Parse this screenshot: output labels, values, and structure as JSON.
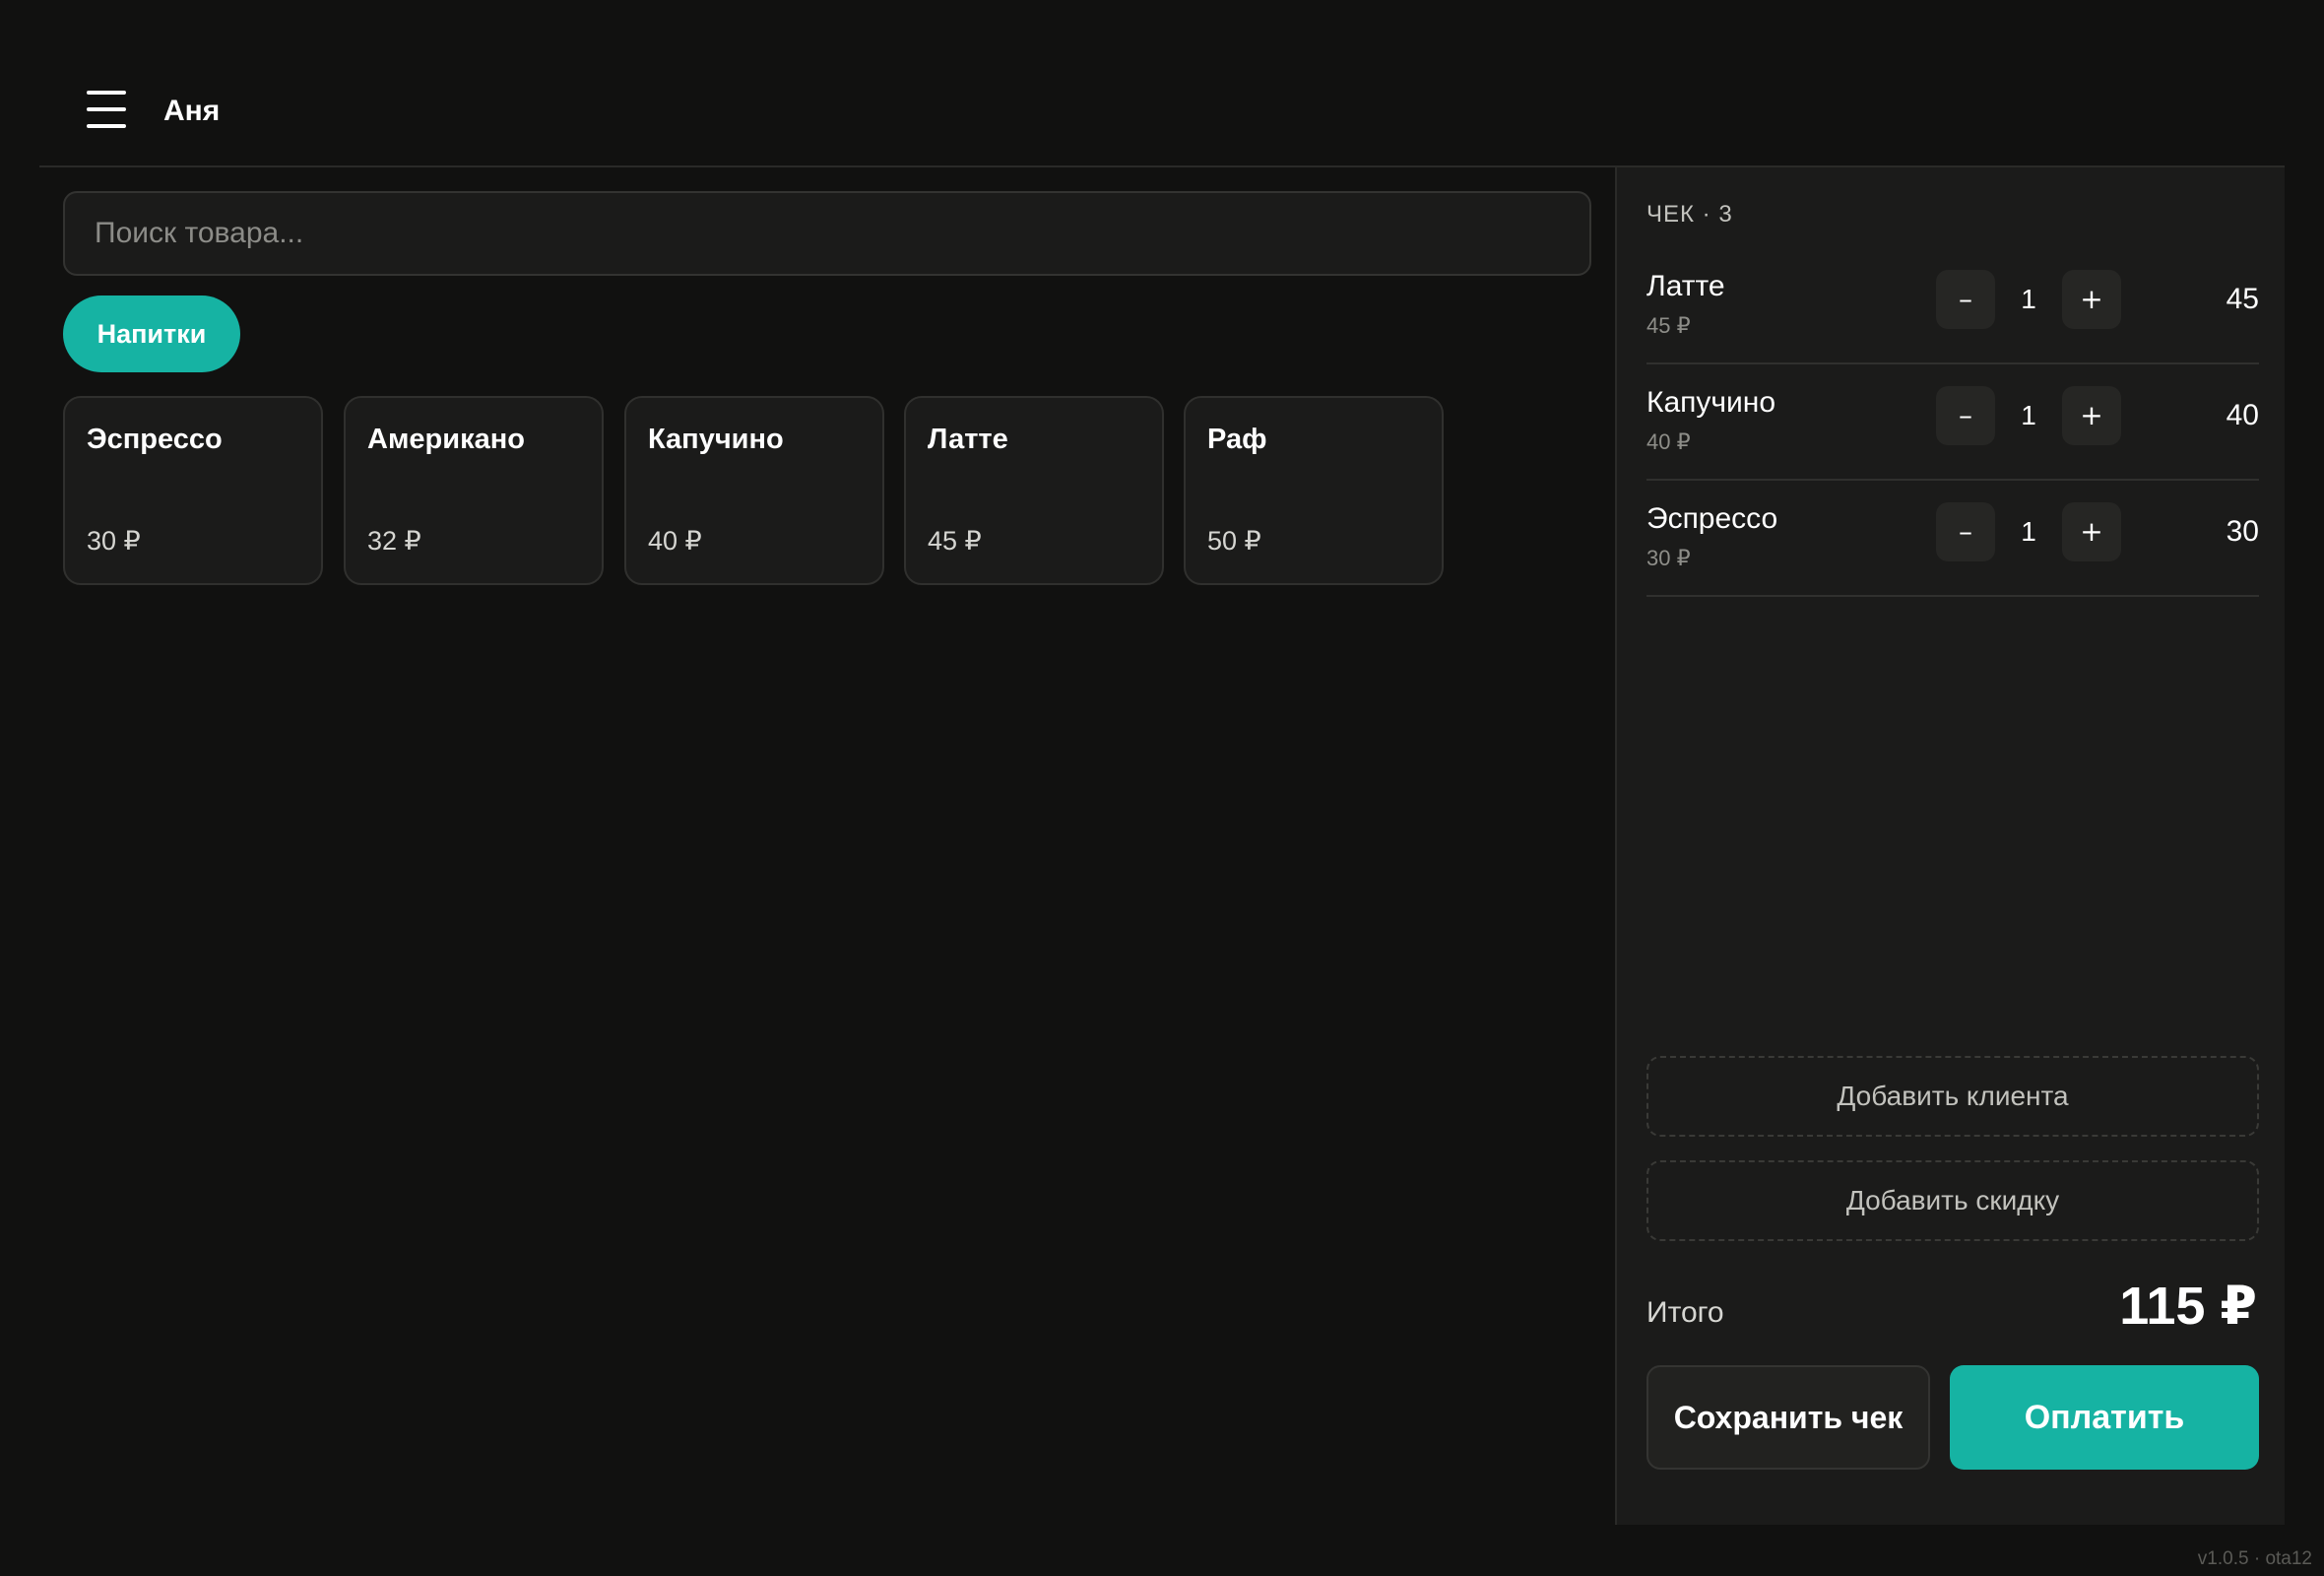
{
  "header": {
    "user_name": "Аня",
    "menu_icon": "hamburger-menu-icon"
  },
  "catalog": {
    "search_placeholder": "Поиск товара...",
    "category": "Напитки",
    "products": [
      {
        "name": "Эспрессо",
        "price": "30 ₽"
      },
      {
        "name": "Американо",
        "price": "32 ₽"
      },
      {
        "name": "Капучино",
        "price": "40 ₽"
      },
      {
        "name": "Латте",
        "price": "45 ₽"
      },
      {
        "name": "Раф",
        "price": "50 ₽"
      }
    ]
  },
  "receipt": {
    "title": "ЧЕК · 3",
    "lines": [
      {
        "name": "Латте",
        "unit_price": "45 ₽",
        "qty": "1",
        "total": "45"
      },
      {
        "name": "Капучино",
        "unit_price": "40 ₽",
        "qty": "1",
        "total": "40"
      },
      {
        "name": "Эспрессо",
        "unit_price": "30 ₽",
        "qty": "1",
        "total": "30"
      }
    ],
    "minus_label": "–",
    "plus_label": "+",
    "add_client_label": "Добавить клиента",
    "add_discount_label": "Добавить скидку",
    "total_label": "Итого",
    "total_value": "115 ₽",
    "save_label": "Сохранить чек",
    "pay_label": "Оплатить"
  },
  "version": "v1.0.5 · ota12",
  "colors": {
    "accent": "#16b3a3",
    "background": "#111110",
    "panel": "#1b1b1a"
  }
}
